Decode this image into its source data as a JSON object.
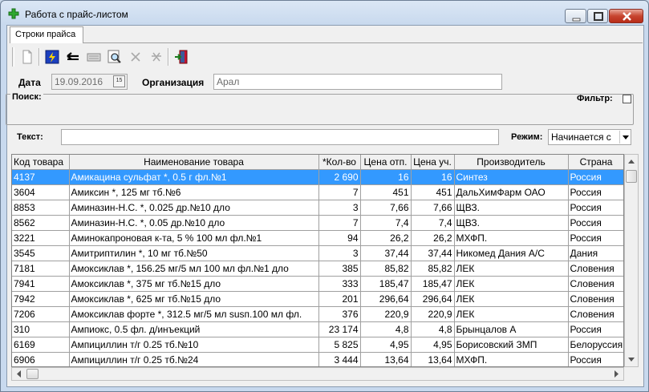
{
  "window": {
    "title": "Работа с прайс-листом"
  },
  "tab": {
    "label": "Строки прайса"
  },
  "toolbar": {
    "buttons": [
      "new-document-icon",
      "lightning-icon",
      "back-arrow-icon",
      "keyboard-icon",
      "search-document-icon",
      "delete-icon",
      "cancel-icon",
      "exit-door-icon"
    ]
  },
  "form": {
    "date_label": "Дата",
    "date_value": "19.09.2016",
    "org_label": "Организация",
    "org_value": "Арал"
  },
  "search": {
    "group_label": "Поиск:",
    "filter_label": "Фильтр:",
    "text_label": "Текст:",
    "text_value": "",
    "mode_label": "Режим:",
    "mode_value": "Начинается с"
  },
  "grid": {
    "columns": [
      "Код товара",
      "Наименование товара",
      "*Кол-во",
      "Цена отп.",
      "Цена уч.",
      "Производитель",
      "Страна"
    ],
    "rows": [
      [
        "4137",
        "Амикацина сульфат *, 0.5 г фл.№1",
        "2 690",
        "16",
        "16",
        "Синтез",
        "Россия"
      ],
      [
        "3604",
        "Амиксин *, 125 мг тб.№6",
        "7",
        "451",
        "451",
        "ДальХимФарм ОАО",
        "Россия"
      ],
      [
        "8853",
        "Аминазин-Н.С. *, 0.025 др.№10 дло",
        "3",
        "7,66",
        "7,66",
        "ЩВЗ.",
        "Россия"
      ],
      [
        "8562",
        "Аминазин-Н.С. *, 0.05 др.№10 дло",
        "7",
        "7,4",
        "7,4",
        "ЩВЗ.",
        "Россия"
      ],
      [
        "3221",
        "Аминокапроновая к-та, 5 % 100 мл фл.№1",
        "94",
        "26,2",
        "26,2",
        "МХФП.",
        "Россия"
      ],
      [
        "3545",
        "Амитриптилин *, 10 мг тб.№50",
        "3",
        "37,44",
        "37,44",
        "Никомед Дания А/С",
        "Дания"
      ],
      [
        "7181",
        "Амоксиклав *, 156.25 мг/5 мл 100 мл фл.№1 дло",
        "385",
        "85,82",
        "85,82",
        "ЛЕК",
        "Словения"
      ],
      [
        "7941",
        "Амоксиклав *, 375 мг тб.№15 дло",
        "333",
        "185,47",
        "185,47",
        "ЛЕК",
        "Словения"
      ],
      [
        "7942",
        "Амоксиклав *, 625 мг тб.№15 дло",
        "201",
        "296,64",
        "296,64",
        "ЛЕК",
        "Словения"
      ],
      [
        "7206",
        "Амоксиклав форте *, 312.5 мг/5 мл susп.100 мл фл.",
        "376",
        "220,9",
        "220,9",
        "ЛЕК",
        "Словения"
      ],
      [
        "310",
        "Ампиокс, 0.5 фл. д/инъекций",
        "23 174",
        "4,8",
        "4,8",
        "Брынцалов А",
        "Россия"
      ],
      [
        "6169",
        "Ампициллин  т/г 0.25 тб.№10",
        "5 825",
        "4,95",
        "4,95",
        "Борисовский ЗМП",
        "Белоруссия"
      ],
      [
        "6906",
        "Ампициллин  т/г 0.25 тб.№24",
        "3 444",
        "13,64",
        "13,64",
        "МХФП.",
        "Россия"
      ]
    ],
    "selected_row": 0
  }
}
